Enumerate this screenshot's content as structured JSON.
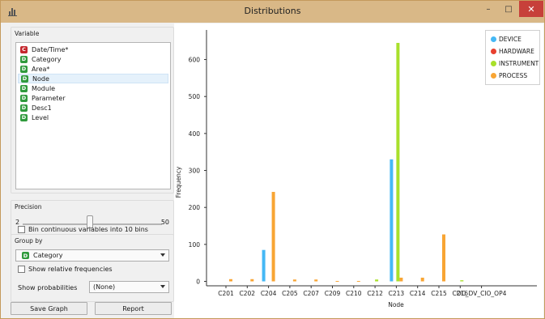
{
  "window": {
    "title": "Distributions",
    "minimize_glyph": "–",
    "maximize_glyph": "□",
    "close_glyph": "✕"
  },
  "variable_panel": {
    "title": "Variable",
    "items": [
      {
        "badge": "C",
        "label": "Date/Time*"
      },
      {
        "badge": "D",
        "label": "Category"
      },
      {
        "badge": "D",
        "label": "Area*"
      },
      {
        "badge": "D",
        "label": "Node"
      },
      {
        "badge": "D",
        "label": "Module"
      },
      {
        "badge": "D",
        "label": "Parameter"
      },
      {
        "badge": "D",
        "label": "Desc1"
      },
      {
        "badge": "D",
        "label": "Level"
      }
    ],
    "selected_index": 3
  },
  "precision": {
    "title": "Precision",
    "min": "2",
    "max": "50",
    "value_fraction": 0.48,
    "bin_label": "Bin continuous variables into 10 bins"
  },
  "group_by": {
    "title": "Group by",
    "value_badge": "D",
    "value": "Category",
    "relative_label": "Show relative frequencies",
    "prob_label": "Show probabilities",
    "prob_value": "(None)"
  },
  "buttons": {
    "save": "Save Graph",
    "report": "Report"
  },
  "colors": {
    "DEVICE": "#45b8f5",
    "HARDWARE": "#e8402f",
    "INSTRUMENT": "#a8e02b",
    "PROCESS": "#f8a534"
  },
  "chart_data": {
    "type": "bar",
    "xlabel": "Node",
    "ylabel": "Frequency",
    "ylim": [
      -12,
      680
    ],
    "yticks": [
      0,
      100,
      200,
      300,
      400,
      500,
      600
    ],
    "categories": [
      "C201",
      "C202",
      "C204",
      "C205",
      "C207",
      "C209",
      "C210",
      "C212",
      "C213",
      "C214",
      "C215",
      "C216",
      "DC_DV_CIO_OP4"
    ],
    "series": [
      {
        "name": "DEVICE",
        "values": [
          0,
          0,
          85,
          0,
          0,
          0,
          0,
          0,
          330,
          0,
          0,
          0,
          0
        ]
      },
      {
        "name": "HARDWARE",
        "values": [
          0,
          0,
          0,
          0,
          0,
          0,
          0,
          0,
          0,
          0,
          0,
          0,
          0
        ]
      },
      {
        "name": "INSTRUMENT",
        "values": [
          0,
          0,
          0,
          0,
          0,
          0,
          0,
          5,
          645,
          0,
          0,
          3,
          0
        ]
      },
      {
        "name": "PROCESS",
        "values": [
          6,
          6,
          242,
          5,
          5,
          1,
          1,
          0,
          10,
          10,
          127,
          0,
          0
        ]
      }
    ],
    "legend_position": "top-right",
    "grid": false
  }
}
